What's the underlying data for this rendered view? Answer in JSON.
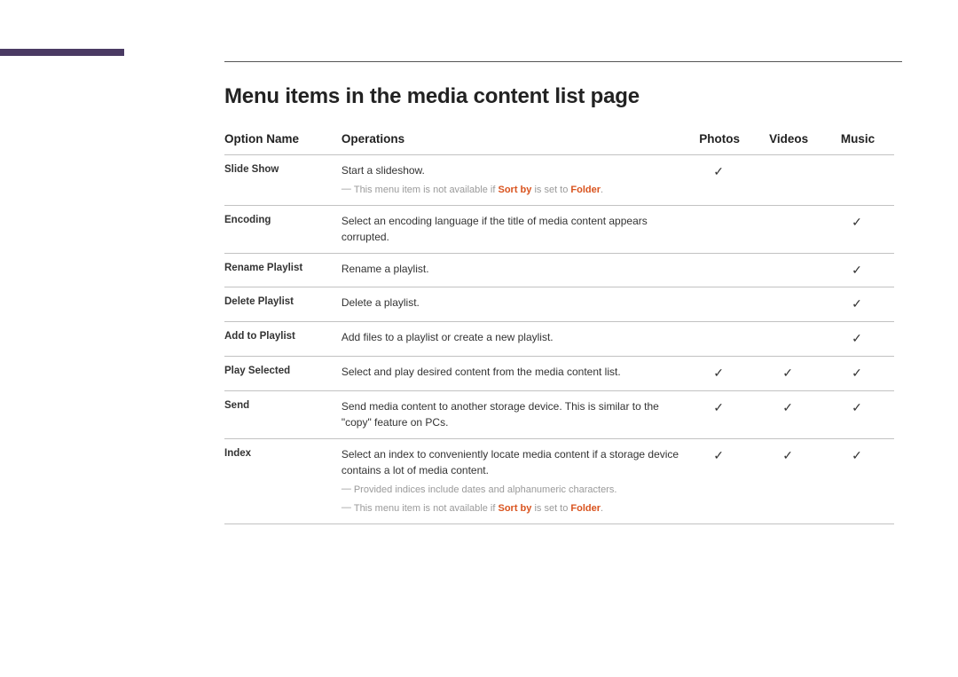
{
  "page": {
    "title": "Menu items in the media content list page"
  },
  "table": {
    "headers": {
      "option": "Option Name",
      "operations": "Operations",
      "photos": "Photos",
      "videos": "Videos",
      "music": "Music"
    },
    "rows": [
      {
        "name": "Slide Show",
        "op": "Start a slideshow.",
        "notes": [
          {
            "pre": "This menu item is not available if ",
            "bold1": "Sort by",
            "mid": " is set to ",
            "bold2": "Folder",
            "post": "."
          }
        ],
        "photos": "✓",
        "videos": "",
        "music": ""
      },
      {
        "name": "Encoding",
        "op": "Select an encoding language if the title of media content appears corrupted.",
        "notes": [],
        "photos": "",
        "videos": "",
        "music": "✓"
      },
      {
        "name": "Rename Playlist",
        "op": "Rename a playlist.",
        "notes": [],
        "photos": "",
        "videos": "",
        "music": "✓"
      },
      {
        "name": "Delete Playlist",
        "op": "Delete a playlist.",
        "notes": [],
        "photos": "",
        "videos": "",
        "music": "✓"
      },
      {
        "name": "Add to Playlist",
        "op": "Add files to a playlist or create a new playlist.",
        "notes": [],
        "photos": "",
        "videos": "",
        "music": "✓"
      },
      {
        "name": "Play Selected",
        "op": "Select and play desired content from the media content list.",
        "notes": [],
        "photos": "✓",
        "videos": "✓",
        "music": "✓"
      },
      {
        "name": "Send",
        "op": "Send media content to another storage device. This is similar to the \"copy\" feature on PCs.",
        "notes": [],
        "photos": "✓",
        "videos": "✓",
        "music": "✓"
      },
      {
        "name": "Index",
        "op": "Select an index to conveniently locate media content if a storage device contains a lot of media content.",
        "notes": [
          {
            "pre": "Provided indices include dates and alphanumeric characters.",
            "bold1": "",
            "mid": "",
            "bold2": "",
            "post": ""
          },
          {
            "pre": "This menu item is not available if ",
            "bold1": "Sort by",
            "mid": " is set to ",
            "bold2": "Folder",
            "post": "."
          }
        ],
        "photos": "✓",
        "videos": "✓",
        "music": "✓"
      }
    ]
  }
}
